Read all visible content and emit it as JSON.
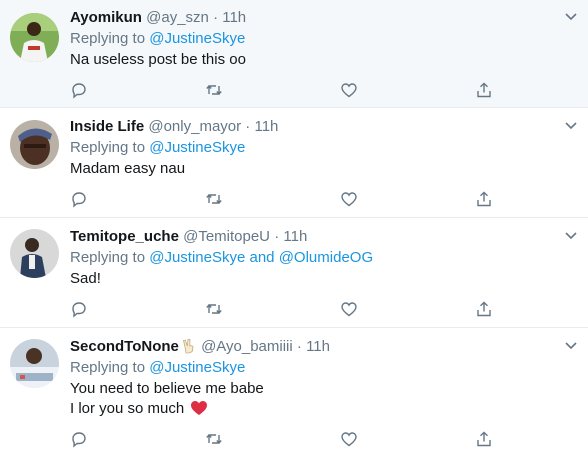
{
  "reply_prefix": "Replying to",
  "tweets": [
    {
      "name": "Ayomikun",
      "handle": "@ay_szn",
      "dot": "·",
      "time": "11h",
      "mentions": [
        "@JustineSkye"
      ],
      "text": [
        "Na useless post be this oo"
      ],
      "highlighted": true
    },
    {
      "name": "Inside Life",
      "handle": "@only_mayor",
      "dot": "·",
      "time": "11h",
      "mentions": [
        "@JustineSkye"
      ],
      "text": [
        "Madam easy nau"
      ],
      "highlighted": false
    },
    {
      "name": "Temitope_uche",
      "handle": "@TemitopeU",
      "dot": "·",
      "time": "11h",
      "mentions": [
        "@JustineSkye",
        "and",
        "@OlumideOG"
      ],
      "text": [
        "Sad!"
      ],
      "highlighted": false
    },
    {
      "name": "SecondToNone",
      "name_emoji": "victory-hand-emoji",
      "handle": "@Ayo_bamiiii",
      "dot": "·",
      "time": "11h",
      "mentions": [
        "@JustineSkye"
      ],
      "text": [
        "You need to believe me babe",
        "I lor you so much"
      ],
      "text_emoji": "red-heart-emoji",
      "highlighted": false
    }
  ],
  "icons": {
    "caret": "chevron-down-icon",
    "reply": "reply-icon",
    "retweet": "retweet-icon",
    "like": "heart-icon",
    "share": "share-icon"
  },
  "colors": {
    "link": "#1b95e0",
    "muted": "#657786",
    "text": "#14171a",
    "highlight_bg": "#f5f8fa",
    "border": "#e6ecf0",
    "heart_red": "#e0245e"
  }
}
